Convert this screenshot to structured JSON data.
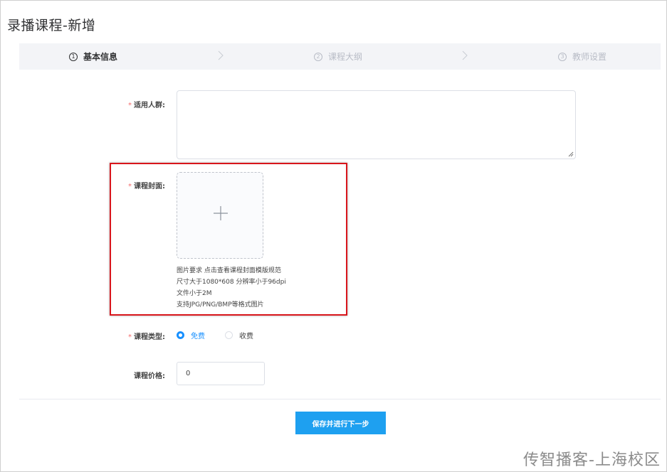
{
  "page": {
    "title": "录播课程-新增"
  },
  "steps": [
    {
      "num": "1",
      "label": "基本信息"
    },
    {
      "num": "2",
      "label": "课程大纲"
    },
    {
      "num": "3",
      "label": "教师设置"
    }
  ],
  "form": {
    "audience": {
      "label": "适用人群:",
      "required_mark": "*",
      "value": ""
    },
    "cover": {
      "label": "课程封面:",
      "required_mark": "*",
      "hints": [
        "图片要求 点击查看课程封面模版规范",
        "尺寸大于1080*608 分辨率小于96dpi",
        "文件小于2M",
        "支持JPG/PNG/BMP等格式图片"
      ]
    },
    "type": {
      "label": "课程类型:",
      "required_mark": "*",
      "options": [
        {
          "label": "免费",
          "selected": true
        },
        {
          "label": "收费",
          "selected": false
        }
      ]
    },
    "price": {
      "label": "课程价格:",
      "value": "0"
    }
  },
  "actions": {
    "submit_label": "保存并进行下一步"
  },
  "watermark": "传智播客-上海校区",
  "colors": {
    "primary": "#1890ff",
    "button": "#1ea0f0",
    "required": "#f56c6c",
    "highlight": "#d9161c"
  }
}
